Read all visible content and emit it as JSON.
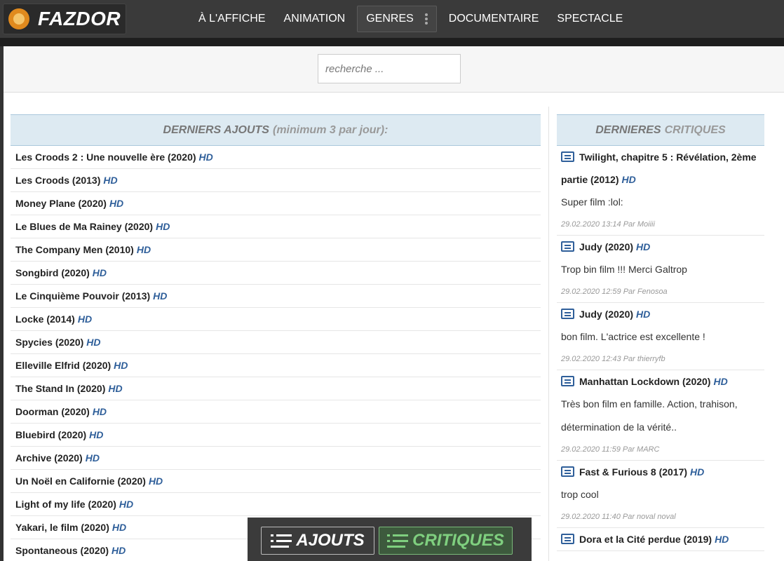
{
  "header": {
    "logo_text": "FAZDOR",
    "nav": [
      {
        "label": "À L'AFFICHE"
      },
      {
        "label": "ANIMATION"
      },
      {
        "label": "GENRES"
      },
      {
        "label": "DOCUMENTAIRE"
      },
      {
        "label": "SPECTACLE"
      }
    ]
  },
  "search": {
    "placeholder": "recherche ..."
  },
  "latest": {
    "title_strong": "DERNIERS AJOUTS",
    "title_light": "(minimum 3 par jour):",
    "items": [
      {
        "title": "Les Croods 2 : Une nouvelle ère (2020)",
        "badge": "HD"
      },
      {
        "title": "Les Croods (2013)",
        "badge": "HD"
      },
      {
        "title": "Money Plane (2020)",
        "badge": "HD"
      },
      {
        "title": "Le Blues de Ma Rainey (2020)",
        "badge": "HD"
      },
      {
        "title": "The Company Men (2010)",
        "badge": "HD"
      },
      {
        "title": "Songbird (2020)",
        "badge": "HD"
      },
      {
        "title": "Le Cinquième Pouvoir (2013)",
        "badge": "HD"
      },
      {
        "title": "Locke (2014)",
        "badge": "HD"
      },
      {
        "title": "Spycies (2020)",
        "badge": "HD"
      },
      {
        "title": "Elleville Elfrid (2020)",
        "badge": "HD"
      },
      {
        "title": "The Stand In (2020)",
        "badge": "HD"
      },
      {
        "title": "Doorman (2020)",
        "badge": "HD"
      },
      {
        "title": "Bluebird (2020)",
        "badge": "HD"
      },
      {
        "title": "Archive (2020)",
        "badge": "HD"
      },
      {
        "title": "Un Noël en Californie (2020)",
        "badge": "HD"
      },
      {
        "title": "Light of my life (2020)",
        "badge": "HD"
      },
      {
        "title": "Yakari, le film (2020)",
        "badge": "HD"
      },
      {
        "title": "Spontaneous (2020)",
        "badge": "HD"
      }
    ]
  },
  "reviews": {
    "title_strong": "DERNIERES",
    "title_light": "CRITIQUES",
    "items": [
      {
        "title": "Twilight, chapitre 5 : Révélation, 2ème partie (2012)",
        "badge": "HD",
        "text": "Super film :lol:",
        "meta": "29.02.2020 13:14 Par Moiiii"
      },
      {
        "title": "Judy (2020)",
        "badge": "HD",
        "text": "Trop bin film !!! Merci Galtrop",
        "meta": "29.02.2020 12:59 Par Fenosoa"
      },
      {
        "title": "Judy (2020)",
        "badge": "HD",
        "text": "bon film. L'actrice est excellente !",
        "meta": "29.02.2020 12:43 Par thierryfb"
      },
      {
        "title": "Manhattan Lockdown (2020)",
        "badge": "HD",
        "text": "Très bon film en famille. Action, trahison, détermination de la vérité..",
        "meta": "29.02.2020 11:59 Par MARC"
      },
      {
        "title": "Fast & Furious 8 (2017)",
        "badge": "HD",
        "text": "trop cool",
        "meta": "29.02.2020 11:40 Par noval noval"
      },
      {
        "title": "Dora et la Cité perdue (2019)",
        "badge": "HD",
        "text": "",
        "meta": ""
      }
    ]
  },
  "bottom": {
    "ajouts_label": "AJOUTS",
    "critiques_label": "CRITIQUES"
  },
  "icons": {
    "logo": "lion-icon",
    "genres_menu": "kebab-menu-icon",
    "review": "comment-icon",
    "list": "list-icon"
  },
  "colors": {
    "accent_hd": "#2f5f9a",
    "header_bg": "#3a3a3a",
    "section_head_bg": "#ddeaf2",
    "critiques_green": "#7fcf7f"
  }
}
